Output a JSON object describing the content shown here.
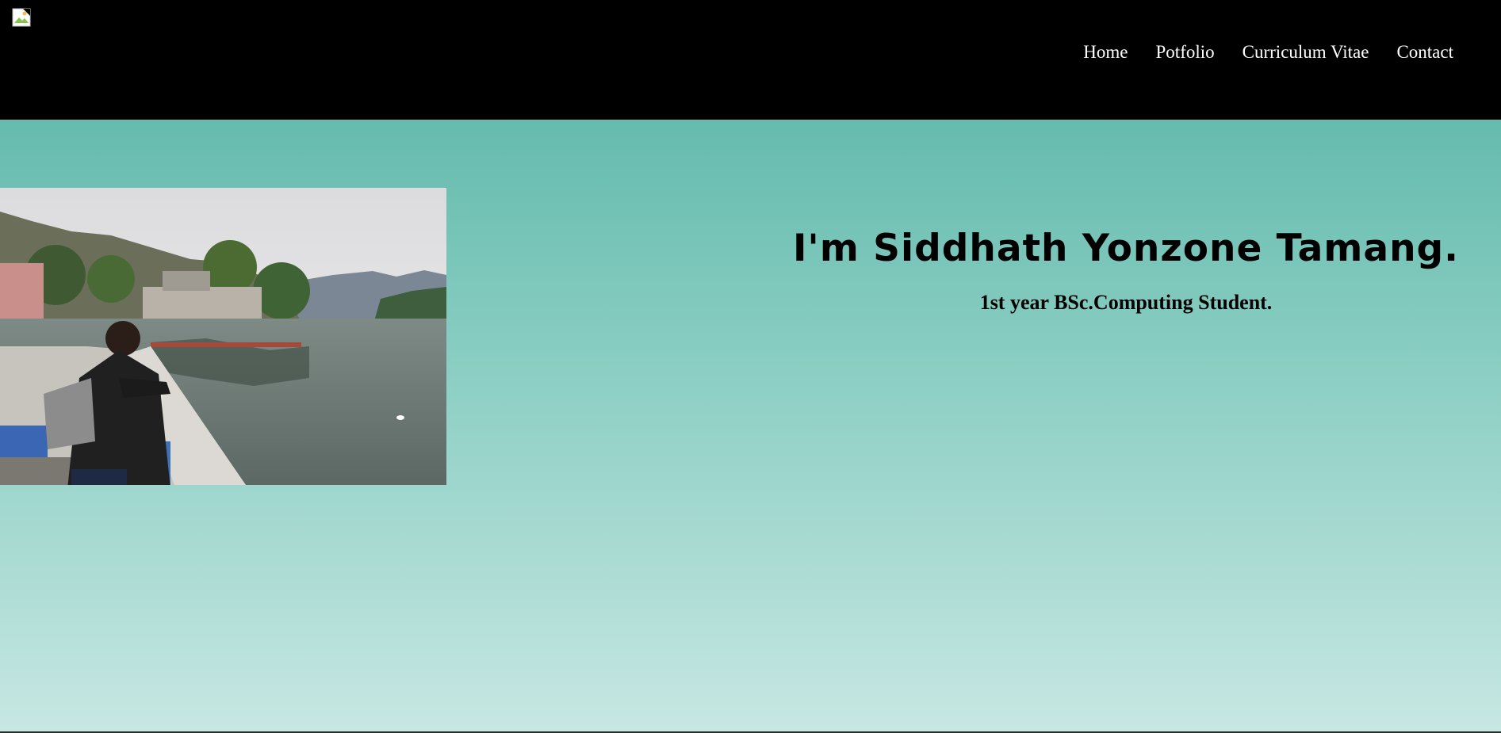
{
  "header": {
    "logo_icon": "broken-image-icon",
    "nav": [
      {
        "label": "Home"
      },
      {
        "label": "Potfolio"
      },
      {
        "label": "Curriculum Vitae"
      },
      {
        "label": "Contact"
      }
    ]
  },
  "hero": {
    "name_heading": "I'm Siddhath Yonzone Tamang.",
    "subtitle": "1st year BSc.Computing Student.",
    "photo_icon": "profile-photo-lake",
    "colors": {
      "header_bg": "#000000",
      "gradient_top": "#65bbae",
      "gradient_bottom": "#c7e7e3"
    }
  }
}
